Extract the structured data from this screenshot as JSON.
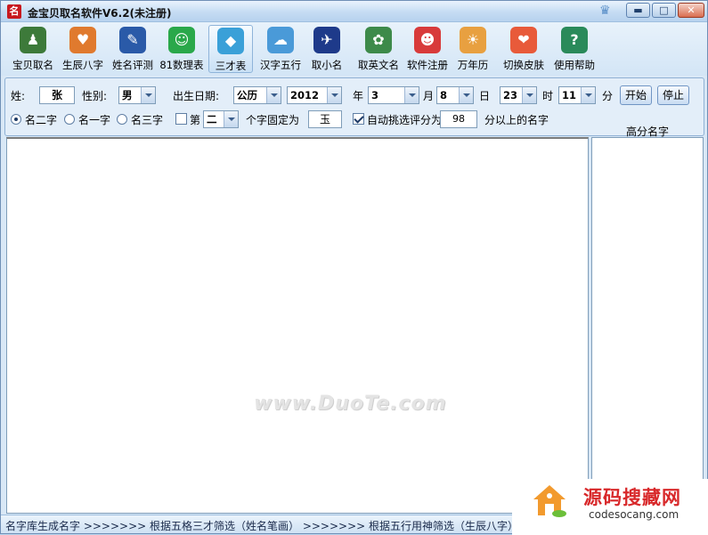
{
  "window": {
    "title": "金宝贝取名软件V6.2(未注册)",
    "app_icon_glyph": "名",
    "min_glyph": "▬",
    "max_glyph": "□",
    "close_glyph": "✕"
  },
  "toolbar": {
    "items": [
      {
        "label": "宝贝取名",
        "icon": "baby-naming-icon",
        "color": "#3d7a3a"
      },
      {
        "label": "生辰八字",
        "icon": "birth-chart-icon",
        "color": "#e07a2e"
      },
      {
        "label": "姓名评测",
        "icon": "name-evaluation-icon",
        "color": "#2a5aa8"
      },
      {
        "label": "81数理表",
        "icon": "numerology-table-icon",
        "color": "#2aa84a"
      },
      {
        "label": "三才表",
        "icon": "three-talents-table-icon",
        "color": "#3aa0d8"
      },
      {
        "label": "汉字五行",
        "icon": "hanzi-five-elements-icon",
        "color": "#4a9ad8"
      },
      {
        "label": "取小名",
        "icon": "nickname-icon",
        "color": "#1e3a8a"
      },
      {
        "label": "取英文名",
        "icon": "english-name-icon",
        "color": "#3d8a4a"
      },
      {
        "label": "软件注册",
        "icon": "register-icon",
        "color": "#d83a3a"
      },
      {
        "label": "万年历",
        "icon": "calendar-icon",
        "color": "#e8a040"
      },
      {
        "label": "切换皮肤",
        "icon": "switch-skin-icon",
        "color": "#e85a3a"
      },
      {
        "label": "使用帮助",
        "icon": "help-icon",
        "color": "#2a8a5a"
      }
    ]
  },
  "form": {
    "surname_label": "姓:",
    "surname_value": "张",
    "gender_label": "性别:",
    "gender_value": "男",
    "birth_label": "出生日期:",
    "calendar_type": "公历",
    "year": "2012",
    "year_label": "年",
    "month": "3",
    "month_label": "月",
    "day": "8",
    "day_label": "日",
    "hour": "23",
    "hour_label": "时",
    "minute": "11",
    "minute_label": "分",
    "start_button": "开始",
    "stop_button": "停止",
    "name_length_options": [
      {
        "label": "名二字",
        "selected": true
      },
      {
        "label": "名一字",
        "selected": false
      },
      {
        "label": "名三字",
        "selected": false
      }
    ],
    "fixed_char_check_label": "第",
    "fixed_char_position": "二",
    "fixed_char_label": "个字固定为",
    "fixed_char_value": "玉",
    "auto_select_label": "自动挑选评分为",
    "auto_select_checked": true,
    "score_threshold": "98",
    "score_suffix": "分以上的名字"
  },
  "results": {
    "high_score_title": "高分名字"
  },
  "watermark": "www.DuoTe.com",
  "status": {
    "text": "名字库生成名字 >>>>>>>  根据五格三才筛选（姓名笔画） >>>>>>>  根据五行用神筛选（生辰八字）>>"
  },
  "badge": {
    "title": "源码搜藏网",
    "url": "codesocang.com"
  }
}
